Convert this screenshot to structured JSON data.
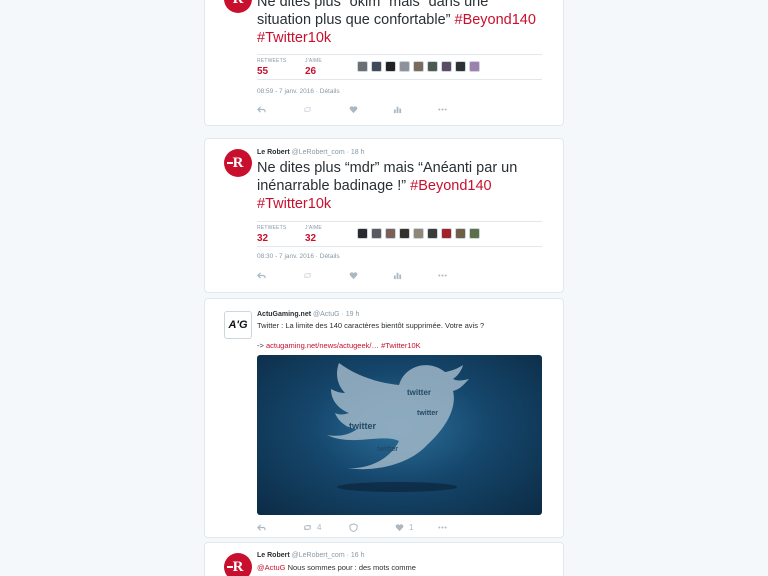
{
  "tweet1": {
    "text": "Ne dites plus “okim” mais “dans une situation plus que confortable”",
    "hashtags": [
      "#Beyond140",
      "#Twitter10k"
    ],
    "retweets_label": "RETWEETS",
    "retweets_value": "55",
    "likes_label": "J'AIME",
    "likes_value": "26",
    "meta": "08:59 - 7 janv. 2016 · Détails"
  },
  "tweet2": {
    "author": "Le Robert",
    "handle": "@LeRobert_com · 18 h",
    "text": "Ne dites plus “mdr” mais “Anéanti par un inénarrable badinage !”",
    "hashtags": [
      "#Beyond140",
      "#Twitter10k"
    ],
    "retweets_label": "RETWEETS",
    "retweets_value": "32",
    "likes_label": "J'AIME",
    "likes_value": "32",
    "meta": "08:30 - 7 janv. 2016 · Détails"
  },
  "tweet3": {
    "author": "ActuGaming.net",
    "handle": "@ActuG · 19 h",
    "text": "Twitter : La limite des 140 caractères bientôt supprimée. Votre avis ?",
    "link_prefix": "->",
    "link": "actugaming.net/news/actugeek/…",
    "hashtag": "#Twitter10K",
    "retweet_count": "4",
    "like_count": "1",
    "image_word": "twitter"
  },
  "tweet4": {
    "author": "Le Robert",
    "handle": "@LeRobert_com · 16 h",
    "mention": "@ActuG",
    "text": "Nous sommes pour : des mots comme"
  },
  "avatars": {
    "robert_letter": "R",
    "actug_letters": "A'G"
  },
  "colors": {
    "brand_red": "#c8102e",
    "border": "#e1e8ed",
    "muted": "#8899a6",
    "background": "#f5f8fa"
  },
  "icons": [
    "reply-icon",
    "retweet-icon",
    "like-icon",
    "stats-icon",
    "more-icon"
  ]
}
